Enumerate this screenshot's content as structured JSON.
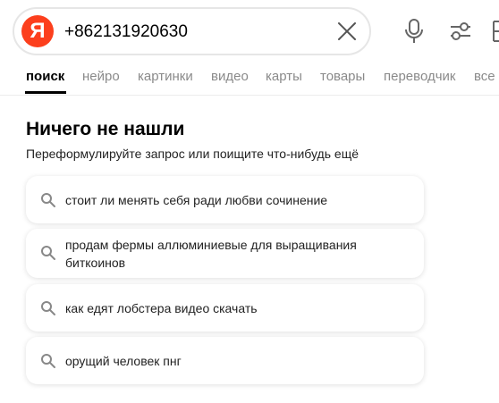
{
  "search": {
    "logo_letter": "Я",
    "query": "+862131920630"
  },
  "tabs": [
    {
      "label": "поиск",
      "active": true
    },
    {
      "label": "нейро"
    },
    {
      "label": "картинки"
    },
    {
      "label": "видео"
    },
    {
      "label": "карты"
    },
    {
      "label": "товары"
    },
    {
      "label": "переводчик"
    },
    {
      "label": "все"
    }
  ],
  "empty_state": {
    "title": "Ничего не нашли",
    "subtitle": "Переформулируйте запрос или поищите что-нибудь ещё"
  },
  "suggestions": [
    "стоит ли менять себя ради любви сочинение",
    "продам фермы аллюминиевые для выращивания биткоинов",
    "как едят лобстера видео скачать",
    "орущий человек пнг"
  ],
  "colors": {
    "logo_red": "#fc3f1d",
    "muted_text": "#8a8a8a"
  },
  "icons": [
    "yandex-logo",
    "close-icon",
    "mic-icon",
    "filters-icon",
    "search-icon"
  ]
}
